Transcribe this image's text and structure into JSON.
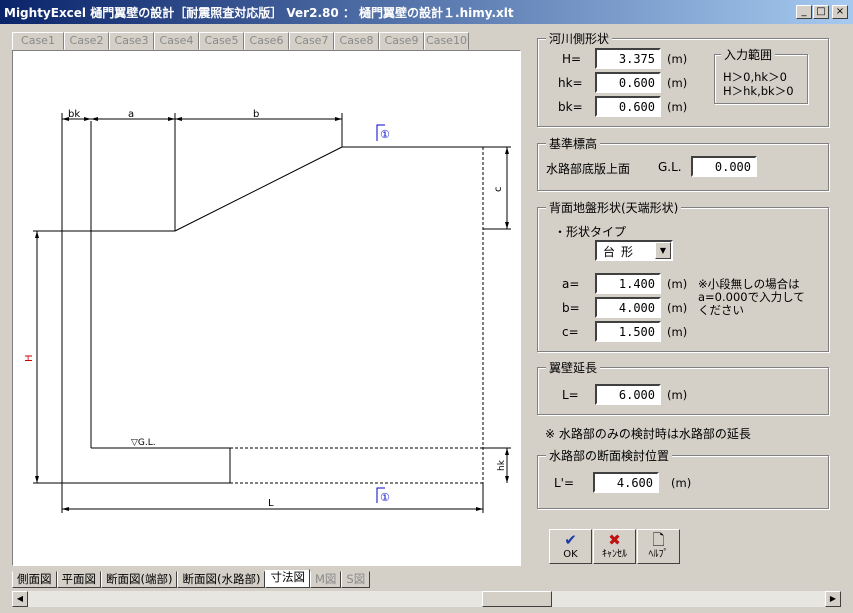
{
  "window": {
    "title": "MightyExcel 樋門翼壁の設計［耐震照査対応版］ Ver2.80 ： 樋門翼壁の設計１.himy.xlt",
    "min": "_",
    "max": "□",
    "close": "×"
  },
  "case_tabs": [
    "Case1",
    "Case2",
    "Case3",
    "Case4",
    "Case5",
    "Case6",
    "Case7",
    "Case8",
    "Case9",
    "Case10"
  ],
  "view_tabs": [
    "側面図",
    "平面図",
    "断面図(端部)",
    "断面図(水路部)",
    "寸法図",
    "M図",
    "S図"
  ],
  "drawing": {
    "dim_bk": "bk",
    "dim_a": "a",
    "dim_b": "b",
    "dim_c": "c",
    "dim_H": "H",
    "dim_hk": "hk",
    "dim_L": "L",
    "gl": "▽G.L.",
    "marker": "①"
  },
  "river": {
    "legend": "河川側形状",
    "H_label": "H=",
    "H_value": "3.375",
    "hk_label": "hk=",
    "hk_value": "0.600",
    "bk_label": "bk=",
    "bk_value": "0.600",
    "unit": "(m)",
    "range_legend": "入力範囲",
    "range_line1": "H＞0,hk＞0",
    "range_line2": "H＞hk,bk＞0"
  },
  "elevation": {
    "legend": "基準標高",
    "label": "水路部底版上面",
    "gl_label": "G.L.",
    "gl_value": "0.000"
  },
  "ground": {
    "legend": "背面地盤形状(天端形状)",
    "type_label": "・形状タイプ",
    "type_value": "台形",
    "a_label": "a=",
    "a_value": "1.400",
    "b_label": "b=",
    "b_value": "4.000",
    "c_label": "c=",
    "c_value": "1.500",
    "unit": "(m)",
    "note1": "※小段無しの場合は",
    "note2": "a=0.000で入力して",
    "note3": "ください"
  },
  "wing": {
    "legend": "翼壁延長",
    "L_label": "L=",
    "L_value": "6.000",
    "unit": "(m)"
  },
  "note": "※ 水路部のみの検討時は水路部の延長",
  "section": {
    "legend": "水路部の断面検討位置",
    "L_label": "L'=",
    "L_value": "4.600",
    "unit": "(m)"
  },
  "buttons": {
    "ok_icon": "✔",
    "ok": "OK",
    "cancel_icon": "✖",
    "cancel": "ｷｬﾝｾﾙ",
    "help_icon": "🗋",
    "help": "ﾍﾙﾌﾟ"
  },
  "colors": {
    "accent_blue": "#0000cc",
    "dim_red": "#cc0000",
    "ok_blue": "#1a3aa6",
    "cancel_red": "#c01010"
  }
}
